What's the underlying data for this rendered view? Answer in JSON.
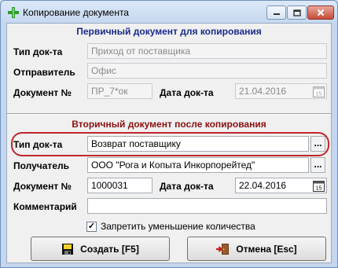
{
  "window": {
    "title": "Копирование документа"
  },
  "primary": {
    "heading": "Первичный документ для копирования",
    "doc_type_label": "Тип док-та",
    "doc_type_value": "Приход от поставщика",
    "sender_label": "Отправитель",
    "sender_value": "Офис",
    "doc_number_label": "Документ №",
    "doc_number_value": "ПР_7*ок",
    "doc_date_label": "Дата док-та",
    "doc_date_value": "21.04.2016"
  },
  "secondary": {
    "heading": "Вторичный документ после копирования",
    "doc_type_label": "Тип док-та",
    "doc_type_value": "Возврат поставщику",
    "recipient_label": "Получатель",
    "recipient_value": "ООО \"Рога и Копыта Инкорпорейтед\"",
    "doc_number_label": "Документ №",
    "doc_number_value": "1000031",
    "doc_date_label": "Дата док-та",
    "doc_date_value": "22.04.2016",
    "comment_label": "Комментарий",
    "comment_value": "",
    "ellipsis": "...",
    "calendar_day": "15"
  },
  "options": {
    "forbid_decrease_label": "Запретить уменьшение количества",
    "forbid_decrease_checked": "✓"
  },
  "buttons": {
    "create_label": "Создать [F5]",
    "cancel_label": "Отмена [Esc]"
  },
  "colors": {
    "heading_blue": "#1a2a8c",
    "heading_red": "#8b1010",
    "highlight": "#c0272d"
  }
}
